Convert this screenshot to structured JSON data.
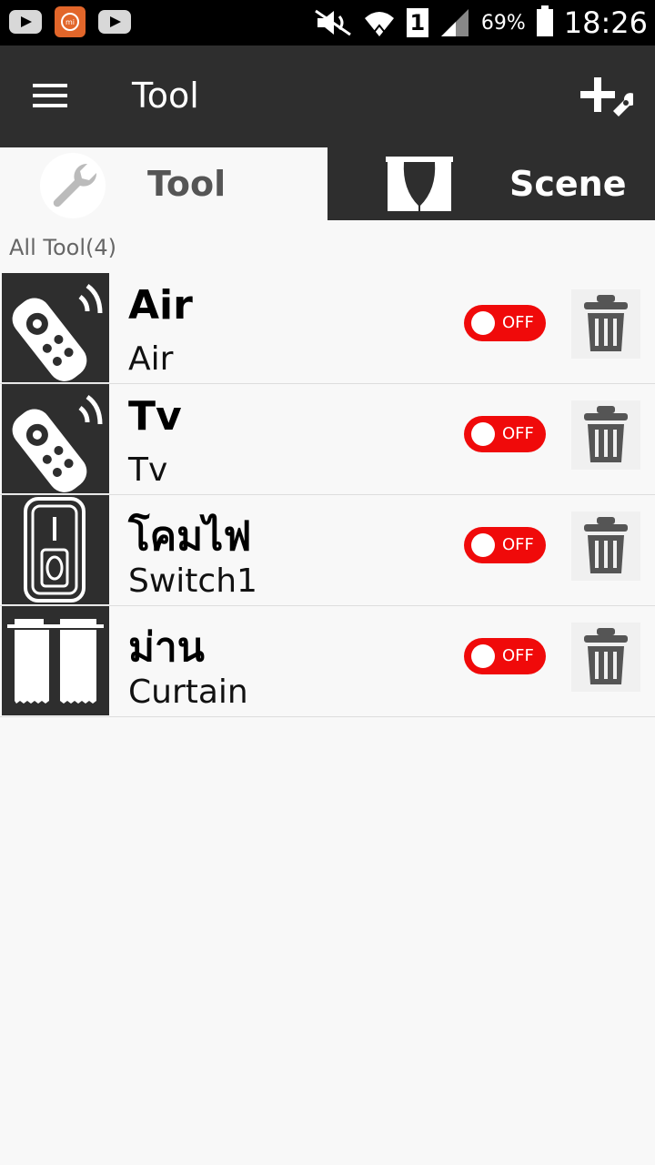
{
  "status_bar": {
    "battery_percent": "69%",
    "sim_slot": "1",
    "time": "18:26",
    "left_icons": [
      "youtube-icon",
      "mi-icon",
      "youtube-icon"
    ]
  },
  "app_bar": {
    "title": "Tool"
  },
  "tabs": {
    "tool": "Tool",
    "scene": "Scene"
  },
  "section_header": "All Tool(4)",
  "devices": [
    {
      "name": "Air",
      "type": "Air",
      "icon": "remote-icon",
      "state": "OFF"
    },
    {
      "name": "Tv",
      "type": "Tv",
      "icon": "remote-icon",
      "state": "OFF"
    },
    {
      "name": "โคมไฟ",
      "type": "Switch1",
      "icon": "switch-icon",
      "state": "OFF"
    },
    {
      "name": "ม่าน",
      "type": "Curtain",
      "icon": "curtain-icon",
      "state": "OFF"
    }
  ],
  "colors": {
    "appbar": "#2e2e2e",
    "toggle_off": "#f00a0a",
    "background": "#f8f8f8"
  }
}
